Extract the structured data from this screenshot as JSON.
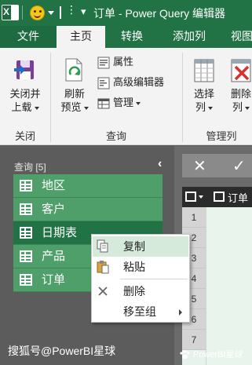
{
  "window": {
    "title": "订单 - Power Query 编辑器"
  },
  "tabs": [
    {
      "label": "文件"
    },
    {
      "label": "主页"
    },
    {
      "label": "转换"
    },
    {
      "label": "添加列"
    },
    {
      "label": "视图"
    }
  ],
  "ribbon": {
    "close_group": {
      "label": "关闭",
      "close_load_line1": "关闭并",
      "close_load_line2": "上载"
    },
    "query_group": {
      "label": "查询",
      "refresh_line1": "刷新",
      "refresh_line2": "预览",
      "properties": "属性",
      "advanced_editor": "高级编辑器",
      "manage": "管理"
    },
    "manage_columns_group": {
      "label": "管理列",
      "choose_line1": "选择",
      "choose_line2": "列",
      "remove_line1": "删除",
      "remove_line2": "列"
    }
  },
  "queries_pane": {
    "header": "查询 [5]",
    "items": [
      {
        "label": "地区"
      },
      {
        "label": "客户"
      },
      {
        "label": "日期表"
      },
      {
        "label": "产品"
      },
      {
        "label": "订单"
      }
    ],
    "selected": "日期表"
  },
  "grid": {
    "column_header": "订单",
    "row_numbers": [
      "1",
      "2",
      "3",
      "4",
      "5",
      "6",
      "7"
    ]
  },
  "context_menu": {
    "items": [
      {
        "label": "复制"
      },
      {
        "label": "粘贴"
      },
      {
        "label": "删除"
      },
      {
        "label": "移至组"
      }
    ]
  },
  "watermark": {
    "main": "搜狐号@PowerBI星球",
    "corner": "PowerBI星球"
  }
}
